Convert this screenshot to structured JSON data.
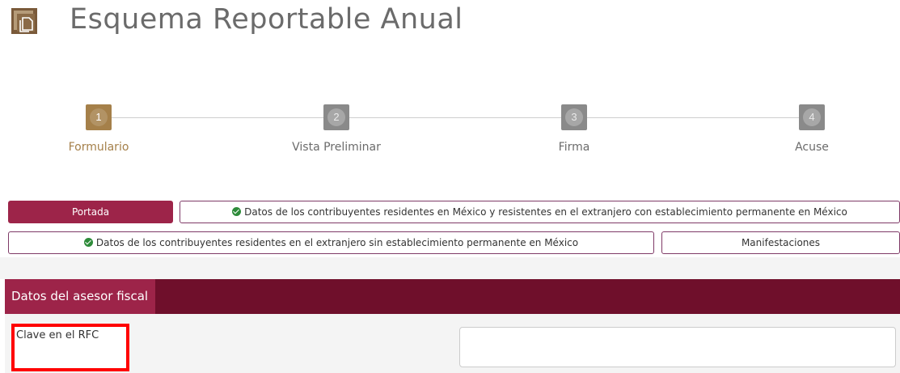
{
  "header": {
    "title": "Esquema Reportable Anual",
    "icon": "copy-documents-icon"
  },
  "stepper": {
    "current_step": 1,
    "steps": [
      {
        "number": "1",
        "label": "Formulario"
      },
      {
        "number": "2",
        "label": "Vista Preliminar"
      },
      {
        "number": "3",
        "label": "Firma"
      },
      {
        "number": "4",
        "label": "Acuse"
      }
    ]
  },
  "tabs": [
    {
      "label": "Portada",
      "completed": false,
      "active": true
    },
    {
      "label": "Datos de los contribuyentes residentes en México y resistentes en el extranjero con establecimiento permanente en México",
      "completed": true,
      "active": false
    },
    {
      "label": "Datos de los contribuyentes residentes en el extranjero sin establecimiento permanente en México",
      "completed": true,
      "active": false
    },
    {
      "label": "Manifestaciones",
      "completed": false,
      "active": false
    }
  ],
  "section": {
    "title": "Datos del asesor fiscal"
  },
  "form": {
    "rfc_label": "Clave en el RFC",
    "rfc_value": ""
  },
  "colors": {
    "primary": "#9d2449",
    "dark": "#6f0f2b",
    "gold": "#a5804a",
    "success": "#2e8b3a",
    "highlight": "#ff0000"
  }
}
